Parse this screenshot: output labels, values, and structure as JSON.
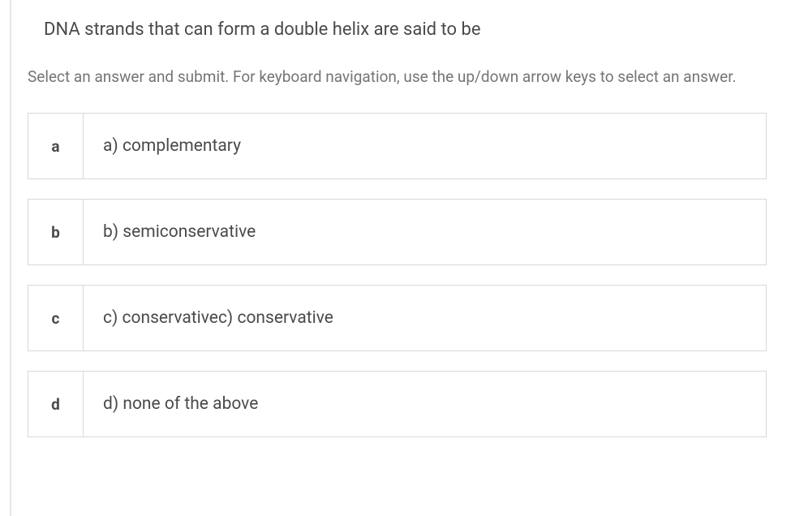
{
  "question": "DNA strands that can form a double helix are said to be",
  "instructions": "Select an answer and submit. For keyboard navigation, use the up/down arrow keys to select an answer.",
  "options": [
    {
      "key": "a",
      "text": "a) complementary"
    },
    {
      "key": "b",
      "text": "b) semiconservative"
    },
    {
      "key": "c",
      "text": "c) conservativec) conservative"
    },
    {
      "key": "d",
      "text": "d) none of the above"
    }
  ]
}
